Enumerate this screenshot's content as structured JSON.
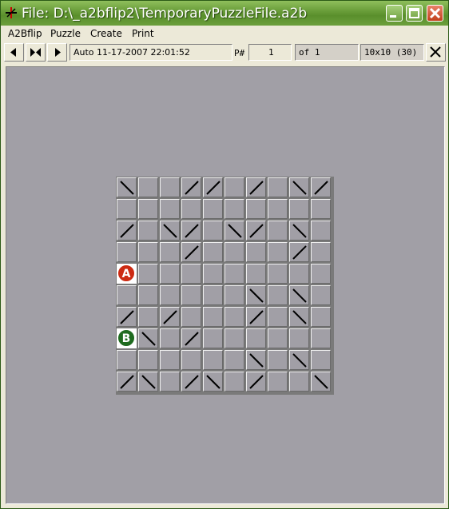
{
  "window": {
    "title": "File: D:\\_a2bflip2\\TemporaryPuzzleFile.a2b"
  },
  "menu": [
    "A2Bflip",
    "Puzzle",
    "Create",
    "Print"
  ],
  "toolbar": {
    "status": "Auto 11-17-2007 22:01:52",
    "p_label": "P#",
    "puzzle_number": "1",
    "of_count": "of 1",
    "grid_size": "10x10 (30)"
  },
  "markers": {
    "a": {
      "label": "A",
      "color": "#cc2a12",
      "row": 4
    },
    "b": {
      "label": "B",
      "color": "#1f6b1f",
      "row": 7
    }
  },
  "board": {
    "rows": 10,
    "cols": 10,
    "cells": [
      "\\..//./.\\/",
      "..........",
      "/.\\/.\\/.\\.",
      ".../..../.",
      "..........",
      "......\\.\\.",
      "/./.../.\\.",
      ".\\./......",
      "......\\.\\.",
      "/\\./\\./..\\"
    ]
  },
  "colors": {
    "titlebar": "#6a9e3a",
    "canvas": "#a19fa6",
    "close_button": "#c2401c"
  }
}
